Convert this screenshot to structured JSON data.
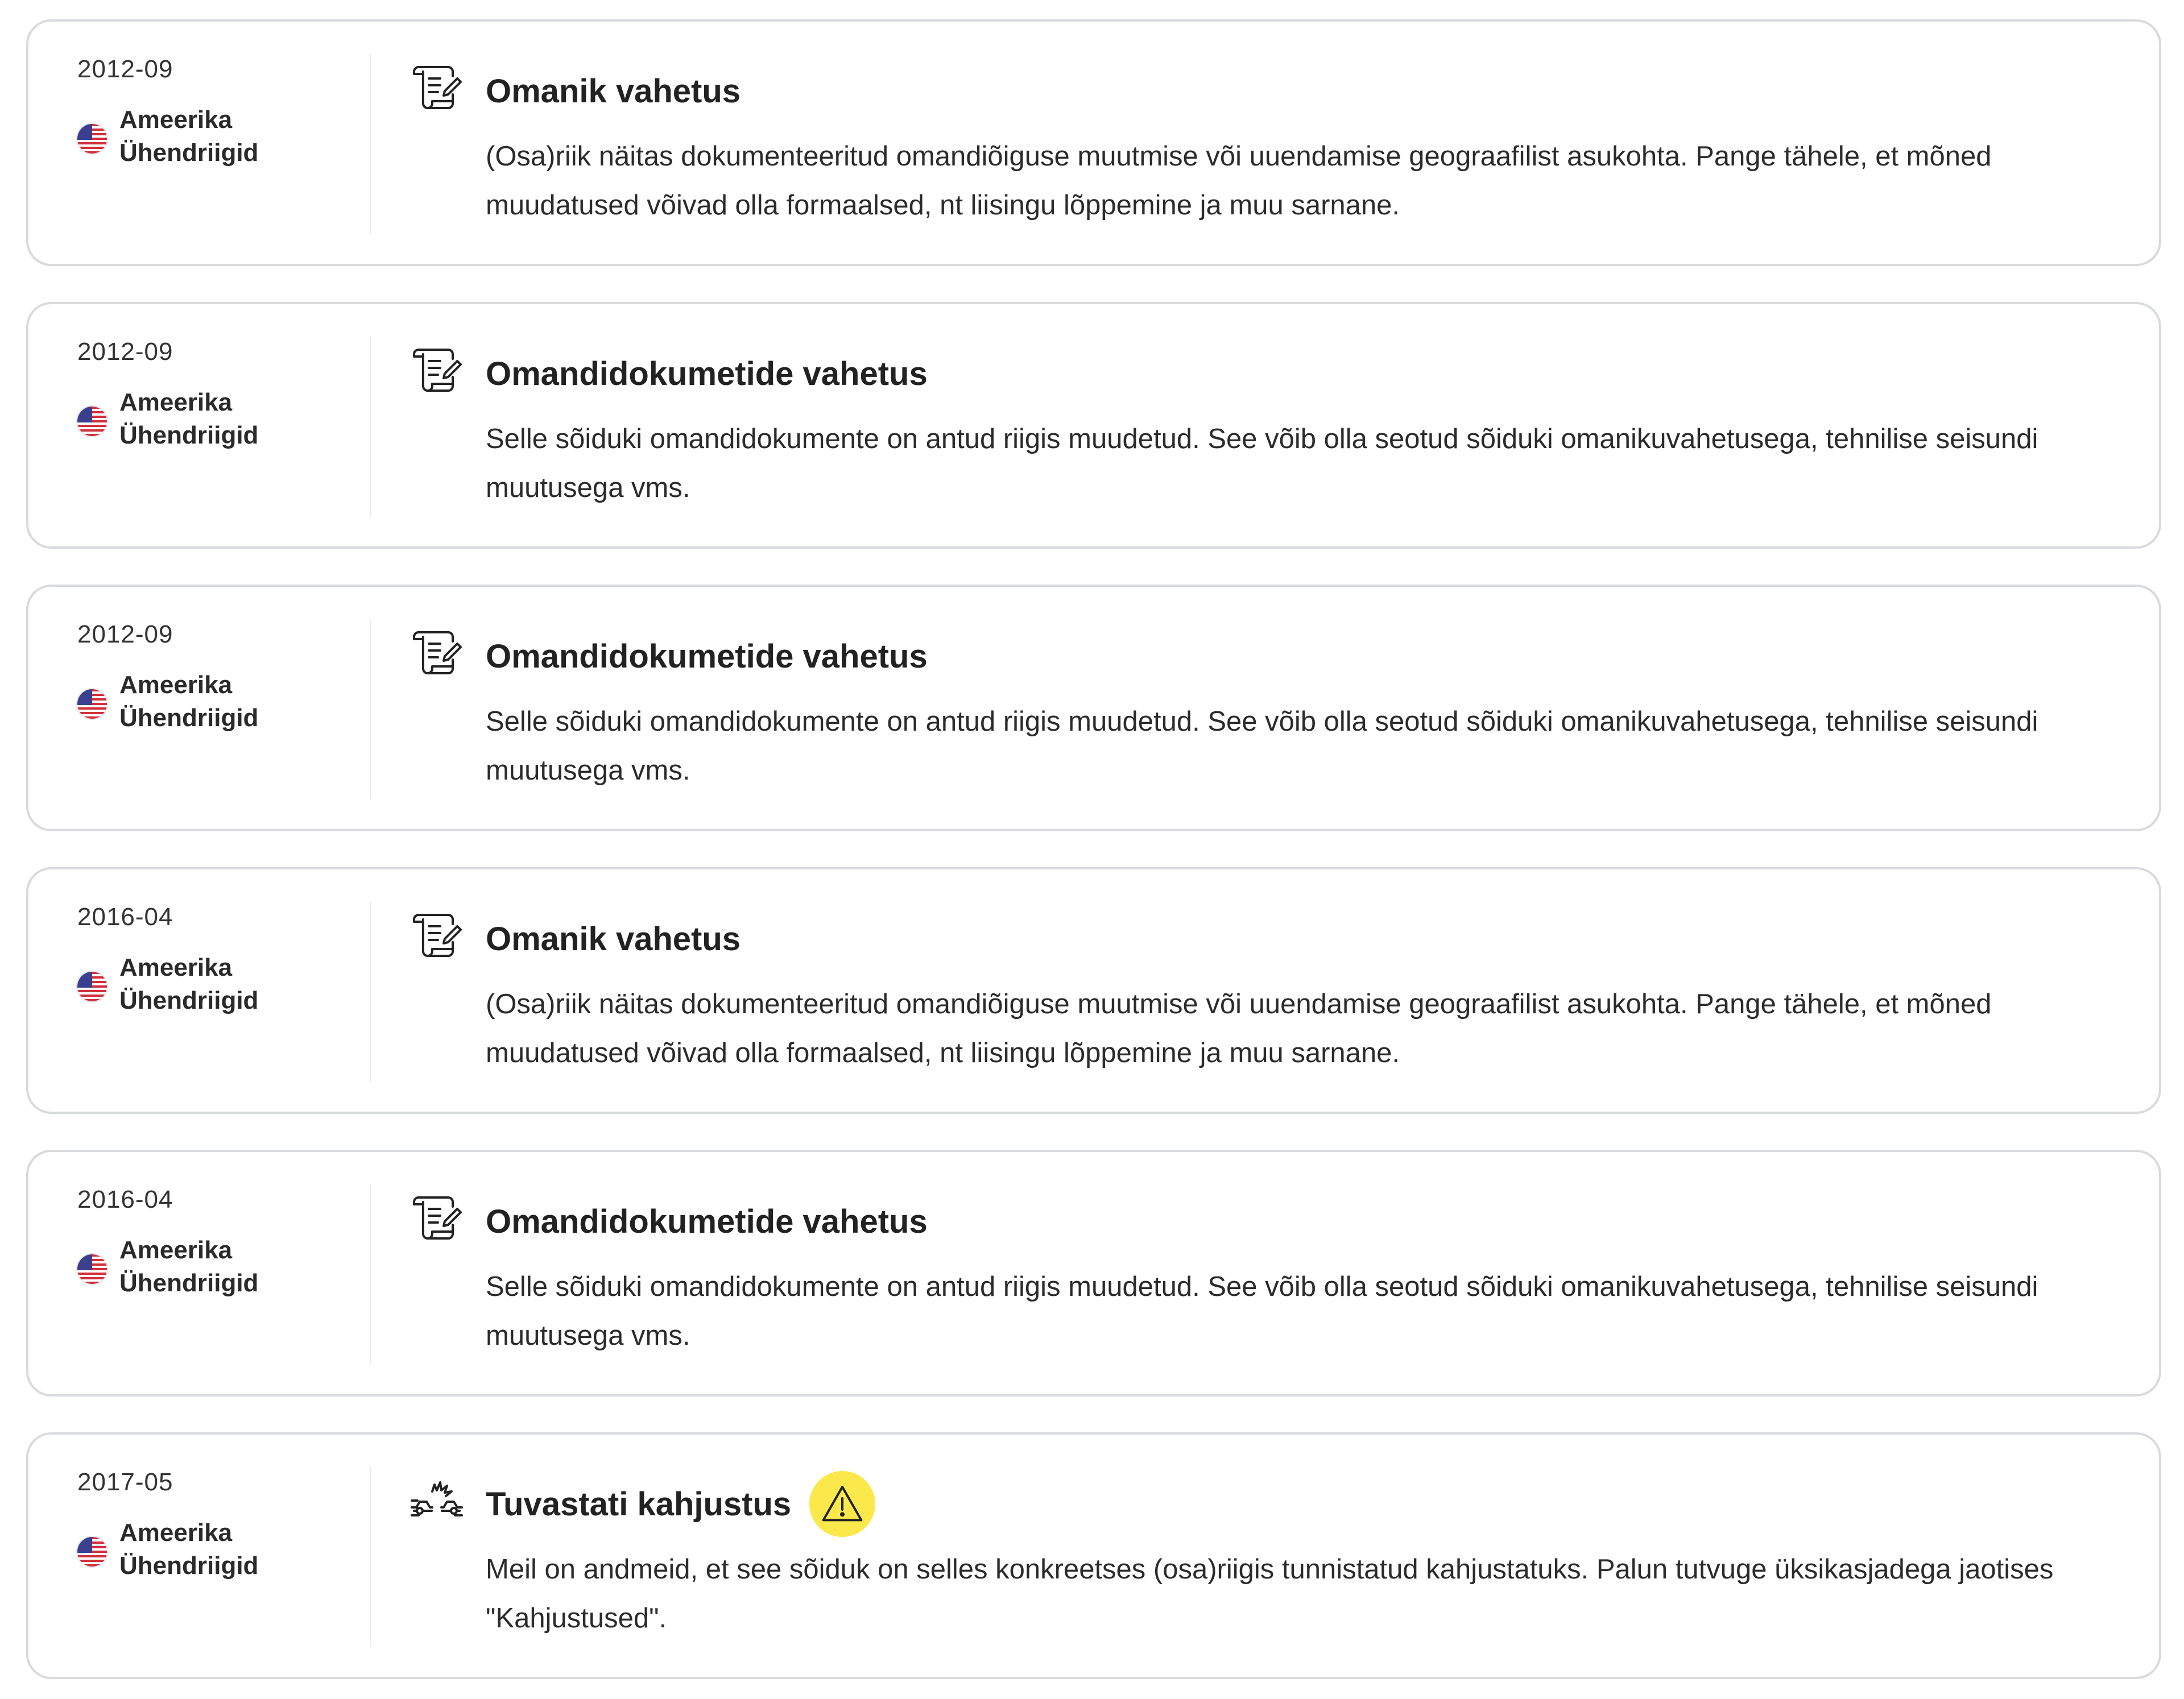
{
  "events": [
    {
      "date": "2012-09",
      "country": "Ameerika Ühendriigid",
      "icon": "document-scroll-icon",
      "title": "Omanik vahetus",
      "description": "(Osa)riik näitas dokumenteeritud omandiõiguse muutmise või uuendamise geograafilist asukohta. Pange tähele, et mõned muudatused võivad olla formaalsed, nt liisingu lõppemine ja muu sarnane.",
      "warning": false
    },
    {
      "date": "2012-09",
      "country": "Ameerika Ühendriigid",
      "icon": "document-scroll-icon",
      "title": "Omandidokumetide vahetus",
      "description": "Selle sõiduki omandidokumente on antud riigis muudetud. See võib olla seotud sõiduki omanikuvahetusega, tehnilise seisundi muutusega vms.",
      "warning": false
    },
    {
      "date": "2012-09",
      "country": "Ameerika Ühendriigid",
      "icon": "document-scroll-icon",
      "title": "Omandidokumetide vahetus",
      "description": "Selle sõiduki omandidokumente on antud riigis muudetud. See võib olla seotud sõiduki omanikuvahetusega, tehnilise seisundi muutusega vms.",
      "warning": false
    },
    {
      "date": "2016-04",
      "country": "Ameerika Ühendriigid",
      "icon": "document-scroll-icon",
      "title": "Omanik vahetus",
      "description": "(Osa)riik näitas dokumenteeritud omandiõiguse muutmise või uuendamise geograafilist asukohta. Pange tähele, et mõned muudatused võivad olla formaalsed, nt liisingu lõppemine ja muu sarnane.",
      "warning": false
    },
    {
      "date": "2016-04",
      "country": "Ameerika Ühendriigid",
      "icon": "document-scroll-icon",
      "title": "Omandidokumetide vahetus",
      "description": "Selle sõiduki omandidokumente on antud riigis muudetud. See võib olla seotud sõiduki omanikuvahetusega, tehnilise seisundi muutusega vms.",
      "warning": false
    },
    {
      "date": "2017-05",
      "country": "Ameerika Ühendriigid",
      "icon": "car-crash-icon",
      "title": "Tuvastati kahjustus",
      "description": "Meil on andmeid, et see sõiduk on selles konkreetses (osa)riigis tunnistatud kahjustatuks. Palun tutvuge üksikasjadega jaotises \"Kahjustused\".",
      "warning": true
    }
  ],
  "colors": {
    "card_border": "#d8dadd",
    "warning_badge": "#fbe84a",
    "flag_blue": "#3b3f8f",
    "flag_red": "#d22f3c"
  }
}
